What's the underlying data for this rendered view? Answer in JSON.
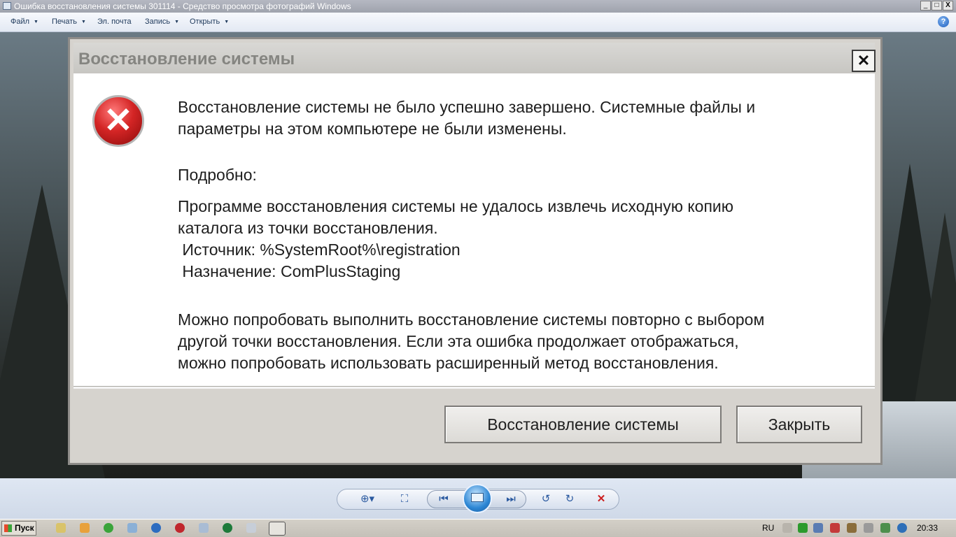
{
  "window": {
    "title": "Ошибка восстановления системы 301114 - Средство просмотра фотографий Windows",
    "min": "_",
    "max": "□",
    "close": "X"
  },
  "menu": [
    {
      "label": "Файл",
      "arrow": "▼"
    },
    {
      "label": "Печать",
      "arrow": "▼"
    },
    {
      "label": "Эл. почта",
      "arrow": ""
    },
    {
      "label": "Запись",
      "arrow": "▼"
    },
    {
      "label": "Открыть",
      "arrow": "▼"
    }
  ],
  "help_icon": "?",
  "dialog": {
    "title": "Восстановление системы",
    "close_glyph": "✕",
    "message_line1": "Восстановление системы не было успешно завершено. Системные файлы и",
    "message_line2": "параметры на этом компьютере не были изменены.",
    "details_label": "Подробно:",
    "details_line1": "Программе восстановления системы не удалось извлечь исходную копию",
    "details_line2": "каталога из точки восстановления.",
    "details_line3": " Источник: %SystemRoot%\\registration",
    "details_line4": " Назначение: ComPlusStaging",
    "advice_line1": "Можно попробовать выполнить восстановление системы повторно с выбором",
    "advice_line2": "другой точки восстановления. Если эта ошибка продолжает отображаться,",
    "advice_line3": "можно попробовать использовать расширенный метод восстановления.",
    "btn_restore": "Восстановление системы",
    "btn_close": "Закрыть",
    "error_icon": "✕"
  },
  "toolbar": {
    "zoom": "⊕▾",
    "fit": "⛶",
    "prev": "⏮",
    "next": "⏭",
    "rotate_left": "↺",
    "rotate_right": "↻",
    "delete": "✕"
  },
  "taskbar": {
    "start": "Пуск",
    "lang": "RU",
    "clock": "20:33"
  },
  "colors": {
    "error_red": "#d42525",
    "delete_red": "#cc1f1f",
    "accent": "#2b5aa0"
  }
}
